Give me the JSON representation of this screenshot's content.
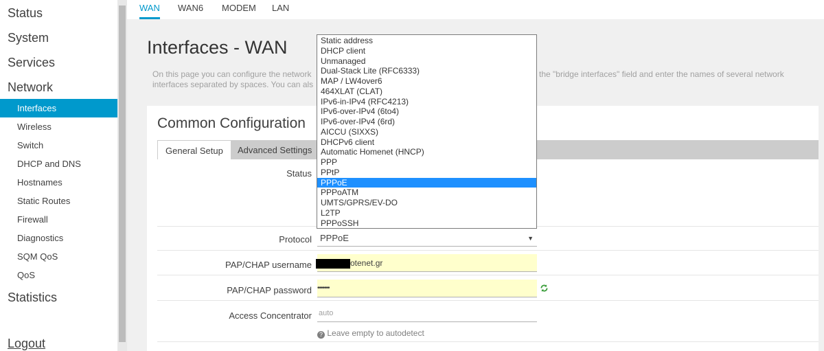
{
  "sidebar": {
    "top_items": [
      "Status",
      "System",
      "Services",
      "Network"
    ],
    "network_items": [
      "Interfaces",
      "Wireless",
      "Switch",
      "DHCP and DNS",
      "Hostnames",
      "Static Routes",
      "Firewall",
      "Diagnostics",
      "SQM QoS",
      "QoS"
    ],
    "statistics": "Statistics",
    "logout": "Logout"
  },
  "tabs": {
    "wan": "WAN",
    "wan6": "WAN6",
    "modem": "MODEM",
    "lan": "LAN"
  },
  "page": {
    "title": "Interfaces - WAN",
    "desc_line1_start": "On this page you can configure the network",
    "desc_line2_start": "interfaces separated by spaces. You can als",
    "desc_line1_end": "the \"bridge interfaces\" field and enter the names of several network"
  },
  "section": {
    "title": "Common Configuration",
    "tab_general": "General Setup",
    "tab_advanced": "Advanced Settings"
  },
  "form": {
    "status_label": "Status",
    "protocol_label": "Protocol",
    "protocol_value": "PPPoE",
    "username_label": "PAP/CHAP username",
    "username_value_suffix": "otenet.gr",
    "password_label": "PAP/CHAP password",
    "password_value": "•••••••",
    "ac_label": "Access Concentrator",
    "ac_placeholder": "auto",
    "ac_hint": "Leave empty to autodetect"
  },
  "protocol_options": [
    "Static address",
    "DHCP client",
    "Unmanaged",
    "Dual-Stack Lite (RFC6333)",
    "MAP / LW4over6",
    "464XLAT (CLAT)",
    "IPv6-in-IPv4 (RFC4213)",
    "IPv6-over-IPv4 (6to4)",
    "IPv6-over-IPv4 (6rd)",
    "AICCU (SIXXS)",
    "DHCPv6 client",
    "Automatic Homenet (HNCP)",
    "PPP",
    "PPtP",
    "PPPoE",
    "PPPoATM",
    "UMTS/GPRS/EV-DO",
    "L2TP",
    "PPPoSSH"
  ],
  "selected_protocol_index": 14,
  "icons": {
    "reveal": "refresh-icon",
    "help": "question-circle-icon",
    "caret": "caret-down-icon"
  },
  "colors": {
    "accent": "#0099cc",
    "selection": "#1e90ff",
    "autofill": "#ffffcc"
  }
}
